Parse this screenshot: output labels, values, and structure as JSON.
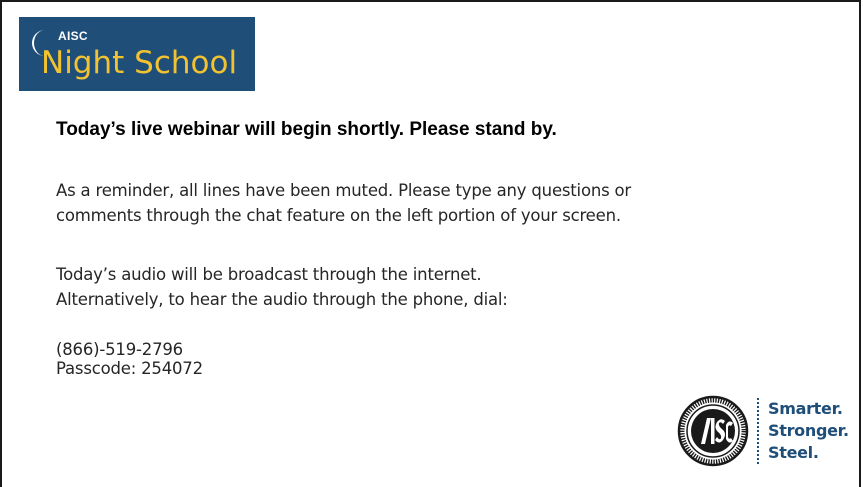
{
  "logo": {
    "org": "AISC",
    "program": "Night School",
    "background_color": "#1f4e79",
    "program_color": "#f2c230",
    "icon": "crescent-moon-icon"
  },
  "headline": "Today’s live webinar will begin shortly.  Please stand by.",
  "reminder": {
    "line1": "As a reminder, all lines have been muted.  Please type any questions or",
    "line2": "comments through the chat feature on the left portion of your screen."
  },
  "audio": {
    "line1": "Today’s audio will be broadcast through the internet.",
    "line2": "Alternatively, to hear the audio through the phone, dial:"
  },
  "dial_in": {
    "phone": "(866)-519-2796",
    "passcode": "Passcode:  254072"
  },
  "brand": {
    "seal_icon": "aisc-seal-icon",
    "tagline": [
      "Smarter.",
      "Stronger.",
      "Steel."
    ],
    "tagline_color": "#1f4e79"
  }
}
